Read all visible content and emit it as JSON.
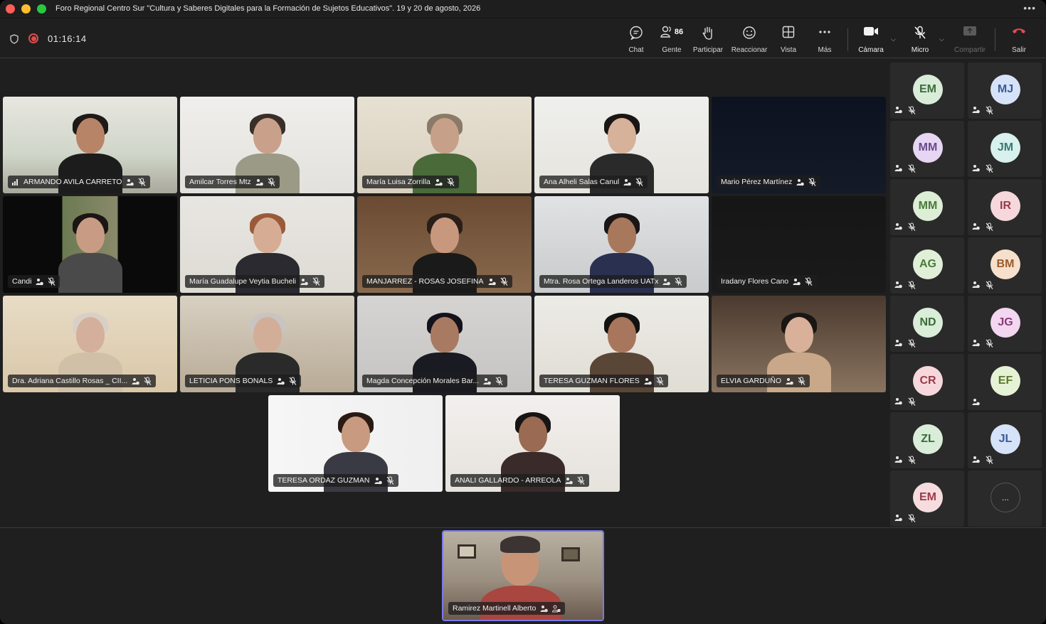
{
  "window": {
    "title": "Foro Regional Centro Sur \"Cultura y Saberes Digitales para la Formación de Sujetos Educativos\". 19 y 20 de agosto, 2026"
  },
  "toolbar": {
    "timer": "01:16:14",
    "people_count": "86",
    "buttons": {
      "chat": "Chat",
      "people": "Gente",
      "raise": "Participar",
      "react": "Reaccionar",
      "view": "Vista",
      "more": "Más",
      "camera": "Cámara",
      "mic": "Micro",
      "share": "Compartir",
      "leave": "Salir"
    }
  },
  "participants": [
    {
      "name": "ARMANDO AVILA CARRETO"
    },
    {
      "name": "Amilcar Torres Mtz"
    },
    {
      "name": "María Luisa Zorrilla"
    },
    {
      "name": "Ana Alheli Salas Canul"
    },
    {
      "name": "Mario Pérez Martínez"
    },
    {
      "name": "Candi"
    },
    {
      "name": "María Guadalupe Veytia Bucheli"
    },
    {
      "name": "MANJARREZ - ROSAS JOSEFINA"
    },
    {
      "name": "Mtra. Rosa Ortega Landeros UATx"
    },
    {
      "name": "Iradany Flores Cano"
    },
    {
      "name": "Dra. Adriana Castillo Rosas _ CII..."
    },
    {
      "name": "LETICIA PONS BONALS"
    },
    {
      "name": "Magda Concepción Morales Bar..."
    },
    {
      "name": "TERESA GUZMAN FLORES"
    },
    {
      "name": "ELVIA GARDUÑO"
    },
    {
      "name": "TERESA ORDAZ GUZMAN"
    },
    {
      "name": "ANALI GALLARDO - ARREOLA"
    }
  ],
  "sidebar": {
    "avatars": [
      {
        "initials": "EM",
        "color": "#d9ecd9",
        "text": "#3a6b3a"
      },
      {
        "initials": "MJ",
        "color": "#d6e2f7",
        "text": "#3a5a9a"
      },
      {
        "initials": "MM",
        "color": "#e6d6f3",
        "text": "#6a4a8a"
      },
      {
        "initials": "JM",
        "color": "#d8f0ee",
        "text": "#3a7a72"
      },
      {
        "initials": "MM",
        "color": "#dcefd6",
        "text": "#4a7a3a"
      },
      {
        "initials": "IR",
        "color": "#f6d8dc",
        "text": "#9a3a4a"
      },
      {
        "initials": "AG",
        "color": "#e0efd8",
        "text": "#4a7a3a"
      },
      {
        "initials": "BM",
        "color": "#f6e0cc",
        "text": "#9a5a2a"
      },
      {
        "initials": "ND",
        "color": "#d9edd9",
        "text": "#3a6b3a"
      },
      {
        "initials": "JG",
        "color": "#f3d6ef",
        "text": "#8a3a7a"
      },
      {
        "initials": "CR",
        "color": "#f6d8dc",
        "text": "#9a3a4a"
      },
      {
        "initials": "EF",
        "color": "#e6f2d6",
        "text": "#5a7a2a"
      },
      {
        "initials": "ZL",
        "color": "#d9edd9",
        "text": "#3a6b3a"
      },
      {
        "initials": "JL",
        "color": "#d6e2f7",
        "text": "#3a5a9a"
      },
      {
        "initials": "EM",
        "color": "#f6dcdf",
        "text": "#9a3a4a"
      }
    ],
    "more_label": "..."
  },
  "self_view": {
    "name": "Ramirez Martinell Alberto"
  },
  "colors": {
    "accent": "#7a7ae6",
    "leave": "#e24b4b",
    "recording": "#e24b4b"
  }
}
